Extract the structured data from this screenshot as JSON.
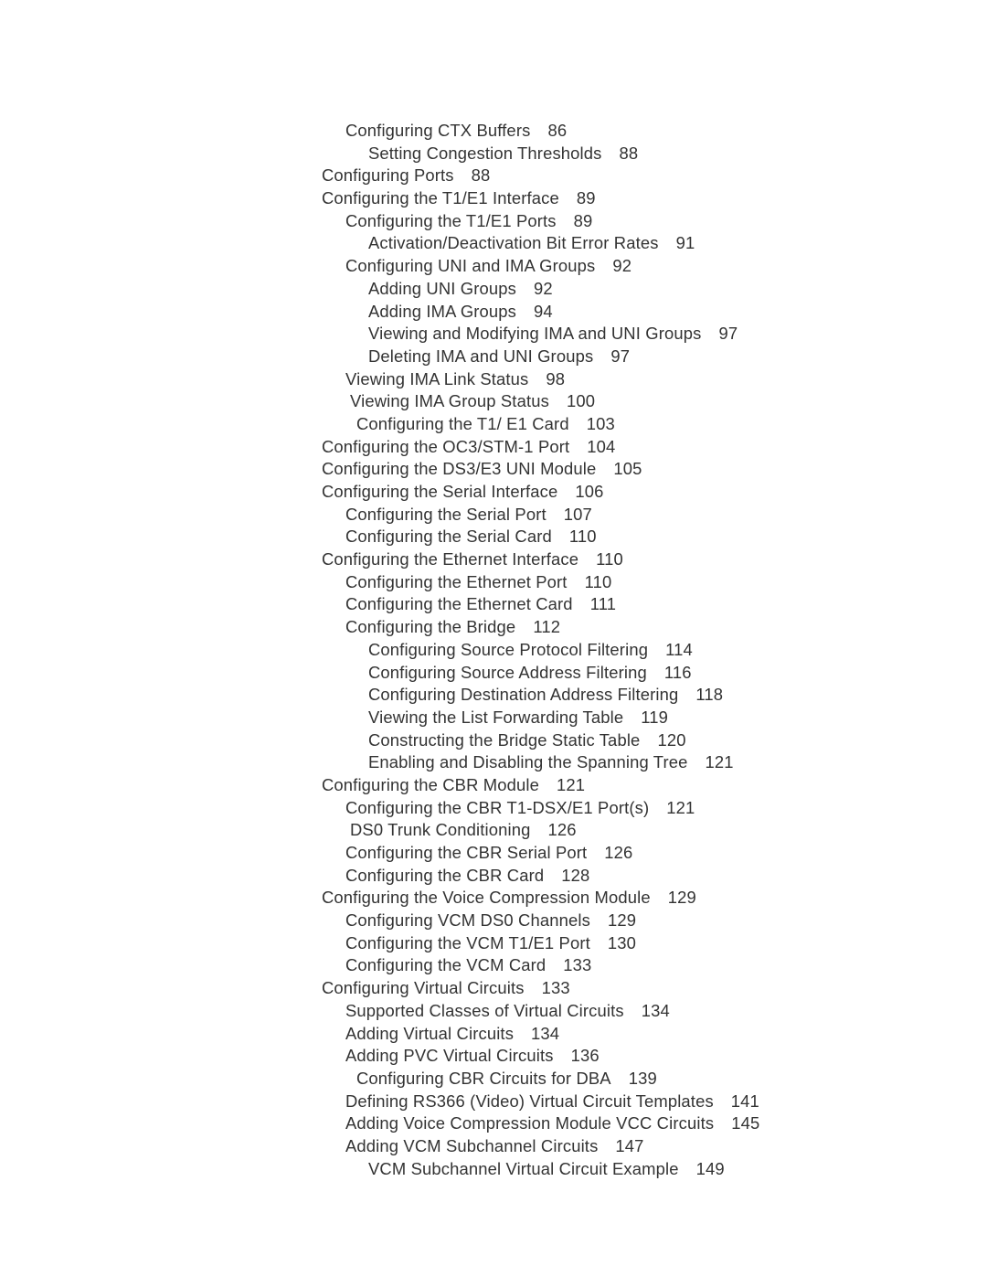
{
  "document": {
    "type": "table-of-contents",
    "text_color": "#333333",
    "background_color": "#ffffff"
  },
  "toc": {
    "entries": [
      {
        "title": "Configuring CTX Buffers",
        "page": "86",
        "level": 1
      },
      {
        "title": "Setting Congestion Thresholds",
        "page": "88",
        "level": 2
      },
      {
        "title": "Configuring Ports",
        "page": "88",
        "level": 0
      },
      {
        "title": "Configuring the T1/E1 Interface",
        "page": "89",
        "level": 0
      },
      {
        "title": "Configuring the T1/E1 Ports",
        "page": "89",
        "level": 1
      },
      {
        "title": "Activation/Deactivation Bit Error Rates",
        "page": "91",
        "level": 2
      },
      {
        "title": "Configuring UNI and IMA Groups",
        "page": "92",
        "level": 1
      },
      {
        "title": "Adding UNI Groups",
        "page": "92",
        "level": 2
      },
      {
        "title": "Adding IMA Groups",
        "page": "94",
        "level": 2
      },
      {
        "title": "Viewing and Modifying IMA and UNI Groups",
        "page": "97",
        "level": 2
      },
      {
        "title": "Deleting IMA and UNI Groups",
        "page": "97",
        "level": 2
      },
      {
        "title": "Viewing IMA Link Status",
        "page": "98",
        "level": 1
      },
      {
        "title": "Viewing IMA Group Status",
        "page": "100",
        "level": "1b"
      },
      {
        "title": "Configuring the T1/ E1 Card",
        "page": "103",
        "level": "1c"
      },
      {
        "title": "Configuring the OC3/STM-1 Port",
        "page": "104",
        "level": 0
      },
      {
        "title": "Configuring the DS3/E3 UNI Module",
        "page": "105",
        "level": 0
      },
      {
        "title": "Configuring the Serial Interface",
        "page": "106",
        "level": 0
      },
      {
        "title": "Configuring the Serial Port",
        "page": "107",
        "level": 1
      },
      {
        "title": "Configuring the Serial Card",
        "page": "110",
        "level": 1
      },
      {
        "title": "Configuring the Ethernet Interface",
        "page": "110",
        "level": 0
      },
      {
        "title": "Configuring the Ethernet Port",
        "page": "110",
        "level": 1
      },
      {
        "title": "Configuring the Ethernet Card",
        "page": "111",
        "level": 1
      },
      {
        "title": "Configuring the Bridge",
        "page": "112",
        "level": 1
      },
      {
        "title": "Configuring Source Protocol Filtering",
        "page": "114",
        "level": 2
      },
      {
        "title": "Configuring Source Address Filtering",
        "page": "116",
        "level": 2
      },
      {
        "title": "Configuring Destination Address Filtering",
        "page": "118",
        "level": 2
      },
      {
        "title": "Viewing the List Forwarding Table",
        "page": "119",
        "level": 2
      },
      {
        "title": "Constructing the Bridge Static Table",
        "page": "120",
        "level": 2
      },
      {
        "title": "Enabling and Disabling the Spanning Tree",
        "page": "121",
        "level": 2
      },
      {
        "title": "Configuring the CBR Module",
        "page": "121",
        "level": 0
      },
      {
        "title": "Configuring the CBR T1-DSX/E1 Port(s)",
        "page": "121",
        "level": 1
      },
      {
        "title": "DS0 Trunk Conditioning",
        "page": "126",
        "level": "1b"
      },
      {
        "title": "Configuring the CBR Serial Port",
        "page": "126",
        "level": 1
      },
      {
        "title": "Configuring the CBR Card",
        "page": "128",
        "level": 1
      },
      {
        "title": "Configuring the Voice Compression Module",
        "page": "129",
        "level": 0
      },
      {
        "title": "Configuring VCM DS0 Channels",
        "page": "129",
        "level": 1
      },
      {
        "title": "Configuring the VCM T1/E1 Port",
        "page": "130",
        "level": 1
      },
      {
        "title": "Configuring the VCM Card",
        "page": "133",
        "level": 1
      },
      {
        "title": "Configuring Virtual Circuits",
        "page": "133",
        "level": 0
      },
      {
        "title": "Supported Classes of Virtual Circuits",
        "page": "134",
        "level": 1
      },
      {
        "title": "Adding Virtual Circuits",
        "page": "134",
        "level": 1
      },
      {
        "title": "Adding PVC Virtual Circuits",
        "page": "136",
        "level": 1
      },
      {
        "title": "Configuring CBR Circuits for DBA",
        "page": "139",
        "level": "1c"
      },
      {
        "title": "Defining RS366 (Video) Virtual Circuit Templates",
        "page": "141",
        "level": 1
      },
      {
        "title": "Adding Voice Compression Module VCC Circuits",
        "page": "145",
        "level": 1
      },
      {
        "title": "Adding VCM Subchannel Circuits",
        "page": "147",
        "level": 1
      },
      {
        "title": "VCM Subchannel Virtual Circuit Example",
        "page": "149",
        "level": 2
      }
    ]
  }
}
